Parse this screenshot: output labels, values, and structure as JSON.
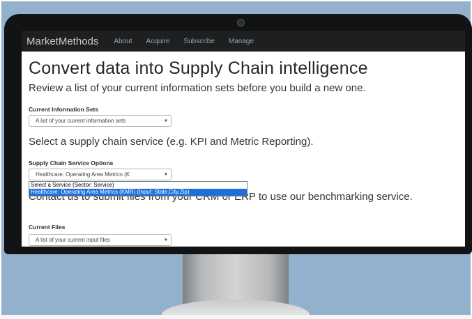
{
  "navbar": {
    "brand": "MarketMethods",
    "links": [
      "About",
      "Acquire",
      "Subscribe",
      "Manage"
    ]
  },
  "main": {
    "headline": "Convert data into Supply Chain intelligence",
    "subline": "Review a list of your current information sets before you build a new one.",
    "info_sets": {
      "label": "Current Information Sets",
      "value": "A list of your current information sets"
    },
    "service_heading": "Select a supply chain service (e.g. KPI and Metric Reporting).",
    "service_options": {
      "label": "Supply Chain Service Options",
      "value": "Healthcare: Operating Area Metrics (K",
      "options": [
        "Select a Service (Sector: Service)",
        "Healthcare: Operating Area Metrics (KMR) (Input: State,City,Zip)"
      ]
    },
    "contact_text": "Contact us to submit files from your CRM or ERP to use our benchmarking service.",
    "current_files": {
      "label": "Current Files",
      "value": "A list of your current input files"
    }
  },
  "icons": {
    "caret": "chevron-down-icon",
    "camera": "webcam-icon"
  }
}
